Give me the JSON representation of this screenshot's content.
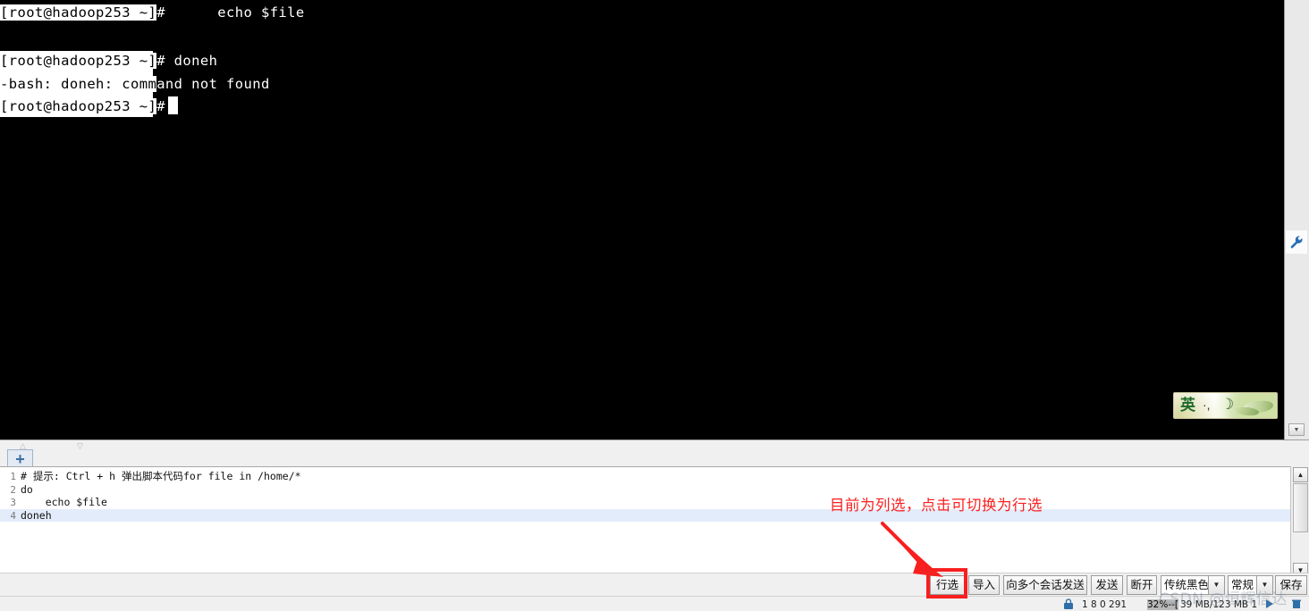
{
  "terminal": {
    "lines": [
      {
        "selected_text": "[root@hadoop253 ~]",
        "plain_text": "#      echo $file"
      },
      {
        "selected_text": "[root@hadoop253 ~]",
        "plain_text": "# doneh"
      },
      {
        "selected_text": "-bash: doneh: comm",
        "plain_text": "and not found"
      },
      {
        "selected_text": "[root@hadoop253 ~]",
        "plain_text": "# "
      }
    ],
    "selection_mode": "column",
    "background_color": "#000000",
    "foreground_color": "#ffffff",
    "cursor_visible": true
  },
  "ime_indicator": {
    "mode_label": "英",
    "dots_glyph": "·,",
    "moon_glyph": "☽",
    "name": "ime-language-bar"
  },
  "terminal_side_strip": {
    "wrench_icon": "wrench-icon",
    "scroll_down_glyph": "▼"
  },
  "editor": {
    "tabstrip": {
      "add_tab_label": "+",
      "scroll_up_glyph": "△",
      "scroll_down_glyph": "▽"
    },
    "lines": [
      {
        "number": "1",
        "text": "# 提示: Ctrl + h 弹出脚本代码for file in /home/*",
        "active": false
      },
      {
        "number": "2",
        "text": "do",
        "active": false
      },
      {
        "number": "3",
        "text": "    echo $file",
        "active": false
      },
      {
        "number": "4",
        "text": "doneh",
        "active": true
      }
    ],
    "active_line_color": "#e3ecfa",
    "scrollbar": {
      "up_glyph": "▲",
      "down_glyph": "▼"
    }
  },
  "toolbar": {
    "row_select_label": "行选",
    "import_label": "导入",
    "send_to_multi_label": "向多个会话发送",
    "send_label": "发送",
    "disconnect_label": "断开",
    "theme_value": "传统黑色",
    "theme_arrow": "▼",
    "style_value": "常规",
    "style_arrow": "▼",
    "save_label": "保存"
  },
  "annotation": {
    "text": "目前为列选，点击可切换为行选",
    "color": "#fa2020",
    "highlight_target": "行选"
  },
  "status_bar": {
    "left_numbers": "1  8  0  291",
    "highlighted_segment": "32%--[",
    "memory": " 39 MB/123 MB  1",
    "lock_icon": "lock-icon",
    "play_icon": "play-icon",
    "trash_icon": "trash-icon"
  },
  "watermark": {
    "text": "CSDN @恒辉信达"
  }
}
